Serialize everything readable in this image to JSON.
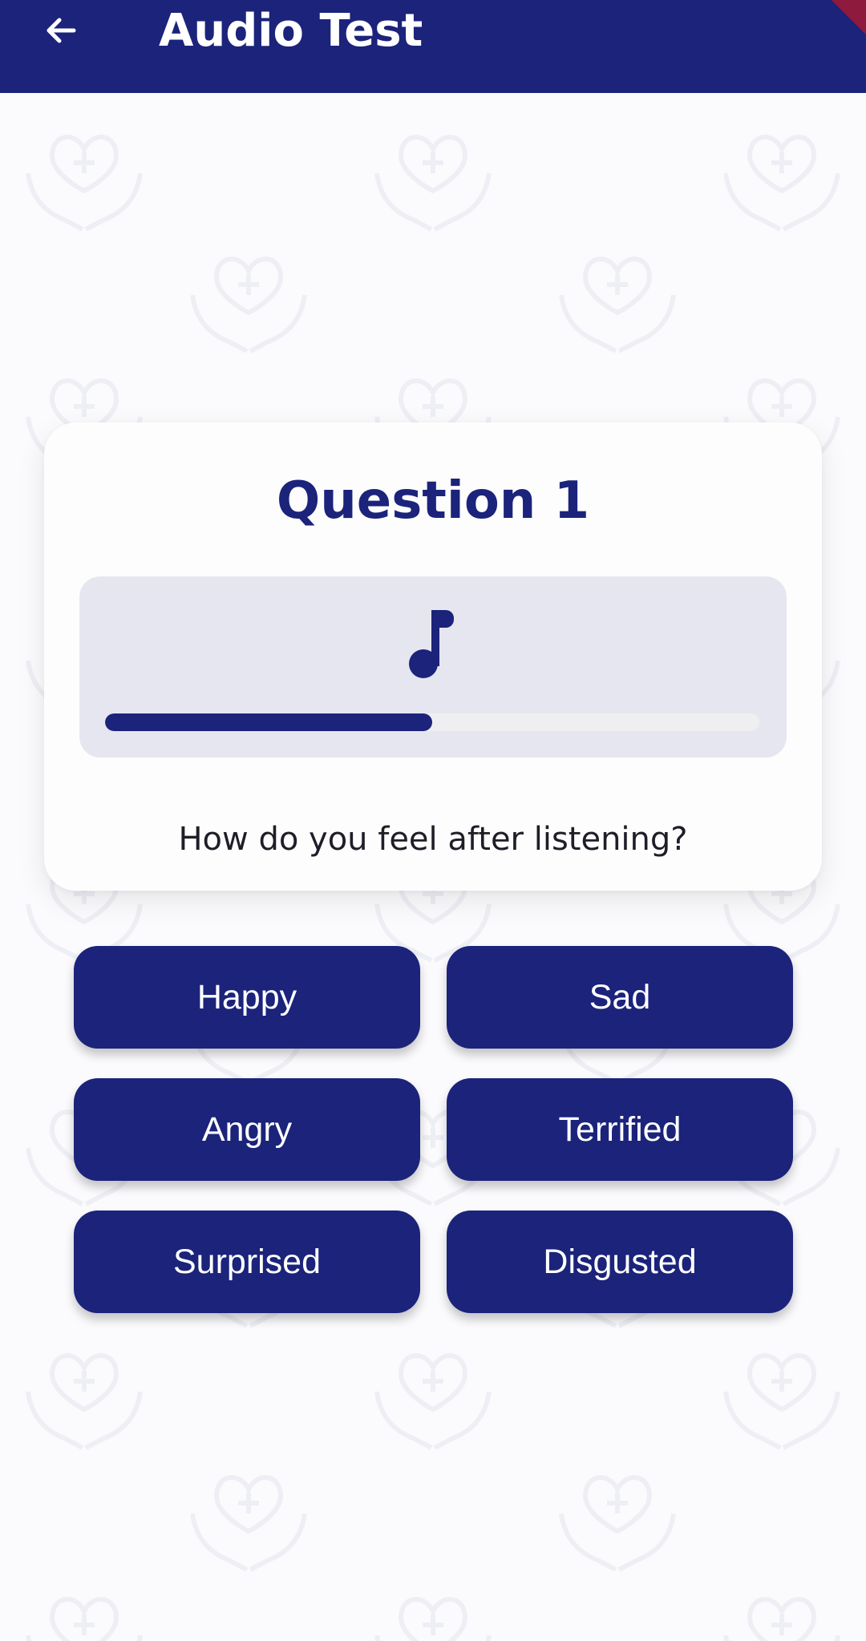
{
  "app_bar": {
    "title": "Audio Test",
    "back_icon": "arrow-left-icon",
    "background": "#1b237b"
  },
  "question": {
    "title": "Question 1",
    "audio_icon": "music-note-icon",
    "progress_fraction": 0.5,
    "prompt": "How do you feel after listening?"
  },
  "answers": [
    {
      "label": "Happy"
    },
    {
      "label": "Sad"
    },
    {
      "label": "Angry"
    },
    {
      "label": "Terrified"
    },
    {
      "label": "Surprised"
    },
    {
      "label": "Disgusted"
    }
  ],
  "colors": {
    "accent": "#1b237b",
    "background": "#fbfbfd",
    "card": "#fdfdfd",
    "player_panel": "#e6e6f0",
    "progress_track": "#efeff1"
  }
}
